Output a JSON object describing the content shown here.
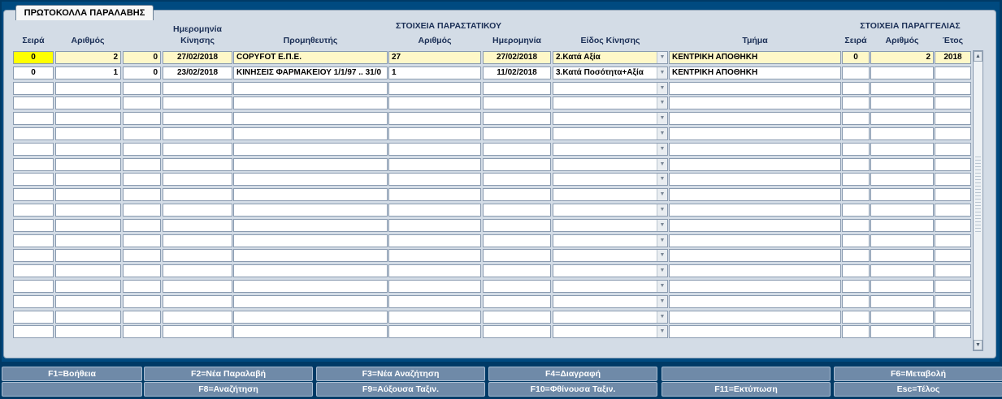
{
  "tab_label": "ΠΡΩΤΟΚΟΛΛΑ ΠΑΡΑΛΑΒΗΣ",
  "group_headers": {
    "document": "ΣΤΟΙΧΕΙΑ ΠΑΡΑΣΤΑΤΙΚΟΥ",
    "order": "ΣΤΟΙΧΕΙΑ ΠΑΡΑΓΓΕΛΙΑΣ"
  },
  "columns": {
    "seira": "Σειρά",
    "arithmos": "Αριθμός",
    "hmer_kinisis_1": "Ημερομηνία",
    "hmer_kinisis_2": "Κίνησης",
    "promitheftis": "Προμηθευτής",
    "doc_arithmos": "Αριθμός",
    "doc_hmerominia": "Ημερομηνία",
    "eidos_kinisis": "Είδος Κίνησης",
    "tmima": "Τμήμα",
    "ord_seira": "Σειρά",
    "ord_arithmos": "Αριθμός",
    "ord_etos": "Έτος"
  },
  "rows": [
    [
      "0",
      "2",
      "0",
      "27/02/2018",
      "COPYFOT Ε.Π.Ε.",
      "27",
      "27/02/2018",
      "2.Κατά Αξία",
      "ΚΕΝΤΡΙΚΗ ΑΠΟΘΗΚΗ",
      "0",
      "2",
      "2018"
    ],
    [
      "0",
      "1",
      "0",
      "23/02/2018",
      "ΚΙΝΗΣΕΙΣ ΦΑΡΜΑΚΕΙΟΥ 1/1/97 .. 31/0",
      "1",
      "11/02/2018",
      "3.Κατά Ποσότητα+Αξία",
      "ΚΕΝΤΡΙΚΗ ΑΠΟΘΗΚΗ",
      "",
      "",
      ""
    ]
  ],
  "empty_row_count": 17,
  "fkeys_row1": [
    "F1=Βοήθεια",
    "F2=Νέα Παραλαβή",
    "F3=Νέα Αναζήτηση",
    "F4=Διαγραφή",
    "",
    "F6=Μεταβολή"
  ],
  "fkeys_row2": [
    "",
    "F8=Αναζήτηση",
    "F9=Αύξουσα Ταξιν.",
    "F10=Φθίνουσα Ταξιν.",
    "F11=Εκτύπωση",
    "Esc=Τέλος"
  ],
  "colors": {
    "background": "#003a66",
    "selected_row": "#fff8c8",
    "focus_cell": "#ffff00",
    "fkey": "#6f8aa8"
  }
}
